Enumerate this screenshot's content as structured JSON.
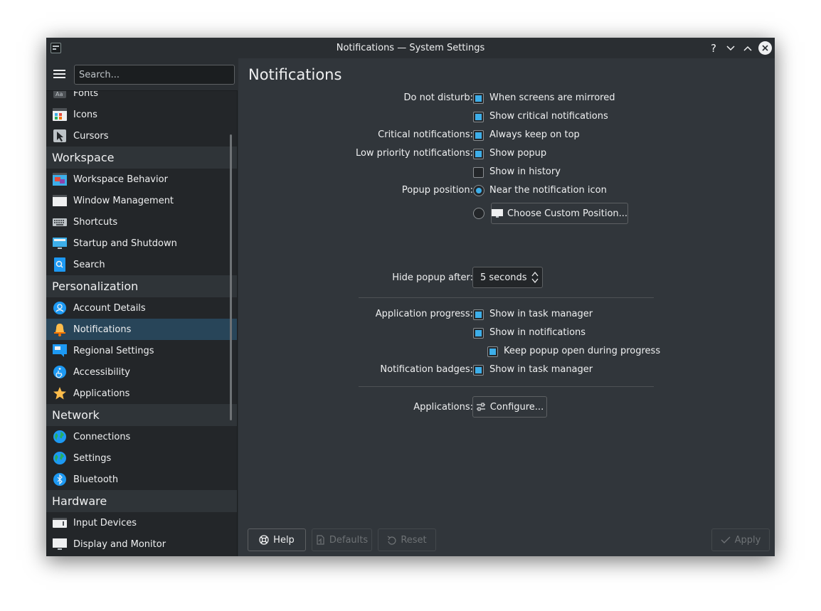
{
  "window": {
    "title": "Notifications — System Settings"
  },
  "titlebar": {
    "help": "?",
    "minimize": "⌄",
    "maximize": "⌃",
    "close": "✕"
  },
  "search": {
    "placeholder": "Search..."
  },
  "sidebar": {
    "items_top": [
      {
        "label": "Fonts",
        "icon": "fonts-icon"
      },
      {
        "label": "Icons",
        "icon": "icons-icon"
      },
      {
        "label": "Cursors",
        "icon": "cursor-icon"
      }
    ],
    "sections": [
      {
        "title": "Workspace",
        "items": [
          {
            "label": "Workspace Behavior",
            "icon": "workspace-behavior-icon"
          },
          {
            "label": "Window Management",
            "icon": "window-management-icon"
          },
          {
            "label": "Shortcuts",
            "icon": "keyboard-icon"
          },
          {
            "label": "Startup and Shutdown",
            "icon": "startup-icon"
          },
          {
            "label": "Search",
            "icon": "search-icon"
          }
        ]
      },
      {
        "title": "Personalization",
        "items": [
          {
            "label": "Account Details",
            "icon": "account-icon"
          },
          {
            "label": "Notifications",
            "icon": "bell-icon"
          },
          {
            "label": "Regional Settings",
            "icon": "regional-icon"
          },
          {
            "label": "Accessibility",
            "icon": "accessibility-icon"
          },
          {
            "label": "Applications",
            "icon": "star-icon"
          }
        ]
      },
      {
        "title": "Network",
        "items": [
          {
            "label": "Connections",
            "icon": "globe-icon"
          },
          {
            "label": "Settings",
            "icon": "globe-icon"
          },
          {
            "label": "Bluetooth",
            "icon": "bluetooth-icon"
          }
        ]
      },
      {
        "title": "Hardware",
        "items": [
          {
            "label": "Input Devices",
            "icon": "input-devices-icon"
          },
          {
            "label": "Display and Monitor",
            "icon": "monitor-icon"
          }
        ]
      }
    ]
  },
  "main": {
    "title": "Notifications",
    "dnd": {
      "label": "Do not disturb:",
      "opt1": "When screens are mirrored",
      "opt2": "Show critical notifications"
    },
    "critical": {
      "label": "Critical notifications:",
      "opt1": "Always keep on top"
    },
    "low": {
      "label": "Low priority notifications:",
      "opt1": "Show popup",
      "opt2": "Show in history"
    },
    "popup": {
      "label": "Popup position:",
      "opt1": "Near the notification icon",
      "custom_button": "Choose Custom Position..."
    },
    "hide": {
      "label": "Hide popup after:",
      "value": "5 seconds"
    },
    "progress": {
      "label": "Application progress:",
      "opt1": "Show in task manager",
      "opt2": "Show in notifications",
      "opt3": "Keep popup open during progress"
    },
    "badges": {
      "label": "Notification badges:",
      "opt1": "Show in task manager"
    },
    "applications": {
      "label": "Applications:",
      "button": "Configure..."
    }
  },
  "footer": {
    "help": "Help",
    "defaults": "Defaults",
    "reset": "Reset",
    "apply": "Apply"
  },
  "colors": {
    "accent": "#3daee9",
    "selected": "#284559",
    "bg": "#31363b",
    "sidebar": "#232629"
  }
}
